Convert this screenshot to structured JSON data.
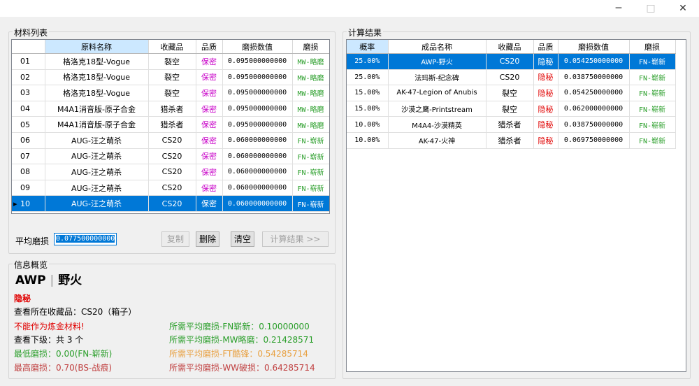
{
  "window": {
    "minimize_icon": "─",
    "maximize_icon": "□",
    "close_icon": "✕"
  },
  "materials": {
    "title": "材料列表",
    "headers": [
      "",
      "原料名称",
      "收藏品",
      "品质",
      "磨损数值",
      "磨损"
    ],
    "rows": [
      {
        "idx": "01",
        "name": "格洛克18型-Vogue",
        "collection": "裂空",
        "quality": "保密",
        "wear": "0.095000000000",
        "grade": "MW-略磨"
      },
      {
        "idx": "02",
        "name": "格洛克18型-Vogue",
        "collection": "裂空",
        "quality": "保密",
        "wear": "0.095000000000",
        "grade": "MW-略磨"
      },
      {
        "idx": "03",
        "name": "格洛克18型-Vogue",
        "collection": "裂空",
        "quality": "保密",
        "wear": "0.095000000000",
        "grade": "MW-略磨"
      },
      {
        "idx": "04",
        "name": "M4A1消音版-原子合金",
        "collection": "猎杀者",
        "quality": "保密",
        "wear": "0.095000000000",
        "grade": "MW-略磨"
      },
      {
        "idx": "05",
        "name": "M4A1消音版-原子合金",
        "collection": "猎杀者",
        "quality": "保密",
        "wear": "0.095000000000",
        "grade": "MW-略磨"
      },
      {
        "idx": "06",
        "name": "AUG-汪之萌杀",
        "collection": "CS20",
        "quality": "保密",
        "wear": "0.060000000000",
        "grade": "FN-崭新"
      },
      {
        "idx": "07",
        "name": "AUG-汪之萌杀",
        "collection": "CS20",
        "quality": "保密",
        "wear": "0.060000000000",
        "grade": "FN-崭新"
      },
      {
        "idx": "08",
        "name": "AUG-汪之萌杀",
        "collection": "CS20",
        "quality": "保密",
        "wear": "0.060000000000",
        "grade": "FN-崭新"
      },
      {
        "idx": "09",
        "name": "AUG-汪之萌杀",
        "collection": "CS20",
        "quality": "保密",
        "wear": "0.060000000000",
        "grade": "FN-崭新"
      },
      {
        "idx": "10",
        "name": "AUG-汪之萌杀",
        "collection": "CS20",
        "quality": "保密",
        "wear": "0.060000000000",
        "grade": "FN-崭新"
      }
    ],
    "selected_row": 9,
    "selected_marker": "▸"
  },
  "avg": {
    "label": "平均磨损",
    "value": "0.077500000000"
  },
  "buttons": {
    "copy": "复制",
    "delete": "删除",
    "clear": "清空",
    "calc": "计算结果 >>"
  },
  "info": {
    "title": "信息概览",
    "weapon": "AWP",
    "divider": "|",
    "skin": "野火",
    "quality": "隐秘",
    "collection_line": "查看所在收藏品：CS20（箱子）",
    "not_material": "不能作为炼金材料!",
    "lower": "查看下级：共 3 个",
    "min_wear": "最低磨损：0.00(FN-崭新)",
    "max_wear": "最高磨损：0.70(BS-战痕)",
    "need_fn": "所需平均磨损-FN崭新：0.10000000",
    "need_mw": "所需平均磨损-MW略磨：0.21428571",
    "need_ft": "所需平均磨损-FT酷锋：0.54285714",
    "need_ww": "所需平均磨损-WW破损：0.64285714"
  },
  "results": {
    "title": "计算结果",
    "headers": [
      "概率",
      "成品名称",
      "收藏品",
      "品质",
      "磨损数值",
      "磨损"
    ],
    "rows": [
      {
        "prob": "25.00%",
        "name": "AWP-野火",
        "collection": "CS20",
        "quality": "隐秘",
        "wear": "0.054250000000",
        "grade": "FN-崭新"
      },
      {
        "prob": "25.00%",
        "name": "法玛斯-纪念碑",
        "collection": "CS20",
        "quality": "隐秘",
        "wear": "0.038750000000",
        "grade": "FN-崭新"
      },
      {
        "prob": "15.00%",
        "name": "AK-47-Legion of Anubis",
        "collection": "裂空",
        "quality": "隐秘",
        "wear": "0.054250000000",
        "grade": "FN-崭新"
      },
      {
        "prob": "15.00%",
        "name": "沙漠之鹰-Printstream",
        "collection": "裂空",
        "quality": "隐秘",
        "wear": "0.062000000000",
        "grade": "FN-崭新"
      },
      {
        "prob": "10.00%",
        "name": "M4A4-沙漠精英",
        "collection": "猎杀者",
        "quality": "隐秘",
        "wear": "0.038750000000",
        "grade": "FN-崭新"
      },
      {
        "prob": "10.00%",
        "name": "AK-47-火神",
        "collection": "猎杀者",
        "quality": "隐秘",
        "wear": "0.069750000000",
        "grade": "FN-崭新"
      }
    ],
    "selected_row": 0
  },
  "colors": {
    "selection": "#0078d7",
    "rare": "#c800c8",
    "hidden": "#e00000",
    "fn": "#2a9e2a",
    "ft": "#e8a040",
    "ww": "#c04040",
    "min": "#2a9e2a",
    "max": "#c04040"
  }
}
